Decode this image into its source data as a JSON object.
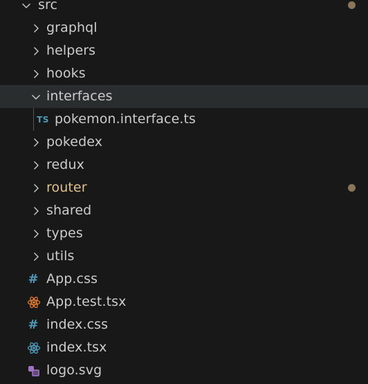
{
  "colors": {
    "background": "#181818",
    "selected_row": "#2a2d2e",
    "text": "#cccccc",
    "modified_text": "#e2c08d",
    "modified_dot": "#8a7559",
    "css_icon": "#519aba",
    "ts_icon": "#519aba",
    "react_test_icon": "#e37933",
    "react_icon": "#519aba",
    "svg_icon": "#a074c4"
  },
  "explorer": {
    "root_folder": {
      "label": "src",
      "icon": "chevron-down-icon",
      "modified_dot": true
    },
    "items": [
      {
        "label": "graphql",
        "icon": "chevron-right-icon",
        "type": "folder"
      },
      {
        "label": "helpers",
        "icon": "chevron-right-icon",
        "type": "folder"
      },
      {
        "label": "hooks",
        "icon": "chevron-right-icon",
        "type": "folder"
      },
      {
        "label": "interfaces",
        "icon": "chevron-down-icon",
        "type": "folder",
        "expanded": true,
        "selected": true
      },
      {
        "label": "pokemon.interface.ts",
        "icon": "ts-file-icon",
        "icon_text": "TS",
        "type": "file",
        "nested": true
      },
      {
        "label": "pokedex",
        "icon": "chevron-right-icon",
        "type": "folder"
      },
      {
        "label": "redux",
        "icon": "chevron-right-icon",
        "type": "folder"
      },
      {
        "label": "router",
        "icon": "chevron-right-icon",
        "type": "folder",
        "modified": true
      },
      {
        "label": "shared",
        "icon": "chevron-right-icon",
        "type": "folder"
      },
      {
        "label": "types",
        "icon": "chevron-right-icon",
        "type": "folder"
      },
      {
        "label": "utils",
        "icon": "chevron-right-icon",
        "type": "folder"
      },
      {
        "label": "App.css",
        "icon": "css-file-icon",
        "icon_text": "#",
        "type": "file"
      },
      {
        "label": "App.test.tsx",
        "icon": "react-test-file-icon",
        "type": "file"
      },
      {
        "label": "index.css",
        "icon": "css-file-icon",
        "icon_text": "#",
        "type": "file"
      },
      {
        "label": "index.tsx",
        "icon": "react-file-icon",
        "type": "file"
      },
      {
        "label": "logo.svg",
        "icon": "svg-file-icon",
        "type": "file"
      }
    ]
  }
}
